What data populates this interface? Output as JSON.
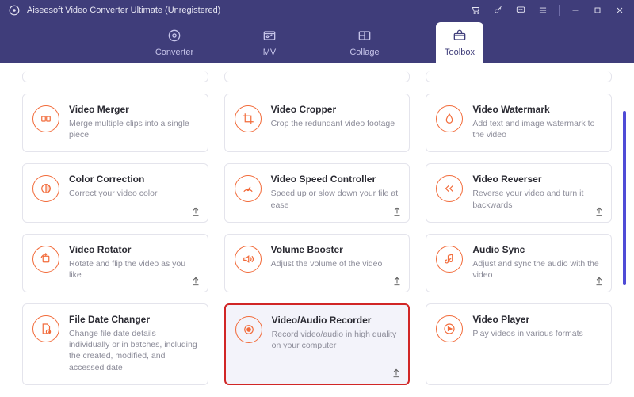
{
  "window": {
    "title": "Aiseesoft Video Converter Ultimate (Unregistered)"
  },
  "tabs": [
    {
      "label": "Converter"
    },
    {
      "label": "MV"
    },
    {
      "label": "Collage"
    },
    {
      "label": "Toolbox"
    }
  ],
  "cards": [
    {
      "title": "Video Merger",
      "desc": "Merge multiple clips into a single piece",
      "pinned": false,
      "highlight": false
    },
    {
      "title": "Video Cropper",
      "desc": "Crop the redundant video footage",
      "pinned": false,
      "highlight": false
    },
    {
      "title": "Video Watermark",
      "desc": "Add text and image watermark to the video",
      "pinned": false,
      "highlight": false
    },
    {
      "title": "Color Correction",
      "desc": "Correct your video color",
      "pinned": true,
      "highlight": false
    },
    {
      "title": "Video Speed Controller",
      "desc": "Speed up or slow down your file at ease",
      "pinned": true,
      "highlight": false
    },
    {
      "title": "Video Reverser",
      "desc": "Reverse your video and turn it backwards",
      "pinned": true,
      "highlight": false
    },
    {
      "title": "Video Rotator",
      "desc": "Rotate and flip the video as you like",
      "pinned": true,
      "highlight": false
    },
    {
      "title": "Volume Booster",
      "desc": "Adjust the volume of the video",
      "pinned": true,
      "highlight": false
    },
    {
      "title": "Audio Sync",
      "desc": "Adjust and sync the audio with the video",
      "pinned": true,
      "highlight": false
    },
    {
      "title": "File Date Changer",
      "desc": "Change file date details individually or in batches, including the created, modified, and accessed date",
      "pinned": false,
      "highlight": false
    },
    {
      "title": "Video/Audio Recorder",
      "desc": "Record video/audio in high quality on your computer",
      "pinned": true,
      "highlight": true
    },
    {
      "title": "Video Player",
      "desc": "Play videos in various formats",
      "pinned": false,
      "highlight": false
    }
  ]
}
